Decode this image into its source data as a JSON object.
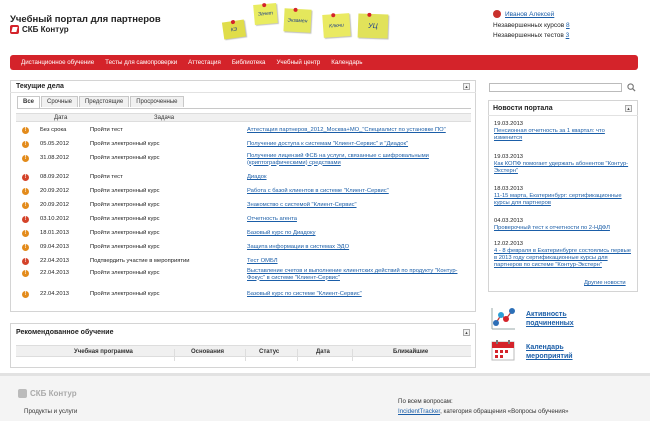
{
  "header": {
    "title": "Учебный портал для партнеров",
    "logo_text": "СКБ Контур",
    "stickers": [
      "КЭ",
      "Зачет",
      "Экзамен",
      "Ключи",
      "УЦ"
    ]
  },
  "user": {
    "name": "Иванов Алексей",
    "unfinished_courses_label": "Незавершенных курсов",
    "unfinished_courses_count": "8",
    "unfinished_tests_label": "Незавершенных тестов",
    "unfinished_tests_count": "3"
  },
  "nav": {
    "items": [
      "Дистанционное обучение",
      "Тесты для самопроверки",
      "Аттестация",
      "Библиотека",
      "Учебный центр",
      "Календарь"
    ]
  },
  "current": {
    "title": "Текущие дела",
    "tabs": [
      "Все",
      "Срочные",
      "Предстоящие",
      "Просроченные"
    ],
    "columns": {
      "date": "Дата",
      "task": "Задача"
    },
    "rows": [
      {
        "date": "Без срока",
        "task": "Пройти тест",
        "subject": "Аттестация партнеров_2012_Москва+МО_\"Специалист по установке ПО\"",
        "status": "warn"
      },
      {
        "date": "05.05.2012",
        "task": "Пройти электронный курс",
        "subject": "Получение доступа к системам \"Клиент-Сервис\" и \"Диадок\"",
        "status": "warn"
      },
      {
        "date": "31.08.2012",
        "task": "Пройти электронный курс",
        "subject": "Получение лицензий ФСБ на услуги, связанные с шифровальными (криптографическими) средствами",
        "status": "warn"
      },
      {
        "date": "08.09.2012",
        "task": "Пройти тест",
        "subject": "Диадок",
        "status": "alert"
      },
      {
        "date": "20.09.2012",
        "task": "Пройти электронный курс",
        "subject": "Работа с базой клиентов в системе \"Клиент-Сервис\"",
        "status": "warn"
      },
      {
        "date": "20.09.2012",
        "task": "Пройти электронный курс",
        "subject": "Знакомство с системой \"Клиент-Сервис\"",
        "status": "warn"
      },
      {
        "date": "03.10.2012",
        "task": "Пройти электронный курс",
        "subject": "Отчетность агента",
        "status": "alert"
      },
      {
        "date": "18.01.2013",
        "task": "Пройти электронный курс",
        "subject": "Базовый курс по Диадоку",
        "status": "warn"
      },
      {
        "date": "09.04.2013",
        "task": "Пройти электронный курс",
        "subject": "Защита информации в системах ЭДО",
        "status": "warn"
      },
      {
        "date": "22.04.2013",
        "task": "Подтвердить участие в мероприятии",
        "subject": "Тест ОМБЛ",
        "status": "alert"
      },
      {
        "date": "22.04.2013",
        "task": "Пройти электронный курс",
        "subject": "Выставление счетов и выполнение клиентских действий по продукту \"Контур-Фокус\" в системе \"Клиент-Сервис\"",
        "status": "warn"
      },
      {
        "date": "22.04.2013",
        "task": "Пройти электронный курс",
        "subject": "Базовый курс по системе \"Клиент-Сервис\"",
        "status": "warn"
      }
    ]
  },
  "recommended": {
    "title": "Рекомендованное обучение",
    "columns": [
      "Учебная программа",
      "Основания",
      "Статус",
      "Дата",
      "Ближайшие"
    ]
  },
  "news": {
    "title": "Новости портала",
    "items": [
      {
        "date": "19.03.2013",
        "text": "Пенсионная отчетность за 1 квартал: что изменится"
      },
      {
        "date": "19.03.2013",
        "text": "Как КОПФ помогает удержать абонентов \"Контур-Экстерн\""
      },
      {
        "date": "18.03.2013",
        "text": "11-15 марта, Екатеринбург: сертификационные курсы для партнеров"
      },
      {
        "date": "04.03.2013",
        "text": "Проверочный тест к отчетности по 2-НДФЛ"
      },
      {
        "date": "12.02.2013",
        "text": "4 - 8 февраля в Екатеринбурге состоялись первые в 2013 году сертификационные курсы для партнеров по системе \"Контур-Экстерн\""
      }
    ],
    "all_link": "Другие новости"
  },
  "side": {
    "activity": "Активность подчиненных",
    "calendar": "Календарь мероприятий"
  },
  "footer": {
    "logo_text": "СКБ Контур",
    "products": "Продукты и услуги",
    "questions": "По всем вопросам:",
    "tracker": "IncidentTracker",
    "category": ", категория обращения «Вопросы обучения»"
  },
  "colors": {
    "accent": "#d4232a",
    "link": "#1b5ea8",
    "sticky": "#e6e85a"
  }
}
